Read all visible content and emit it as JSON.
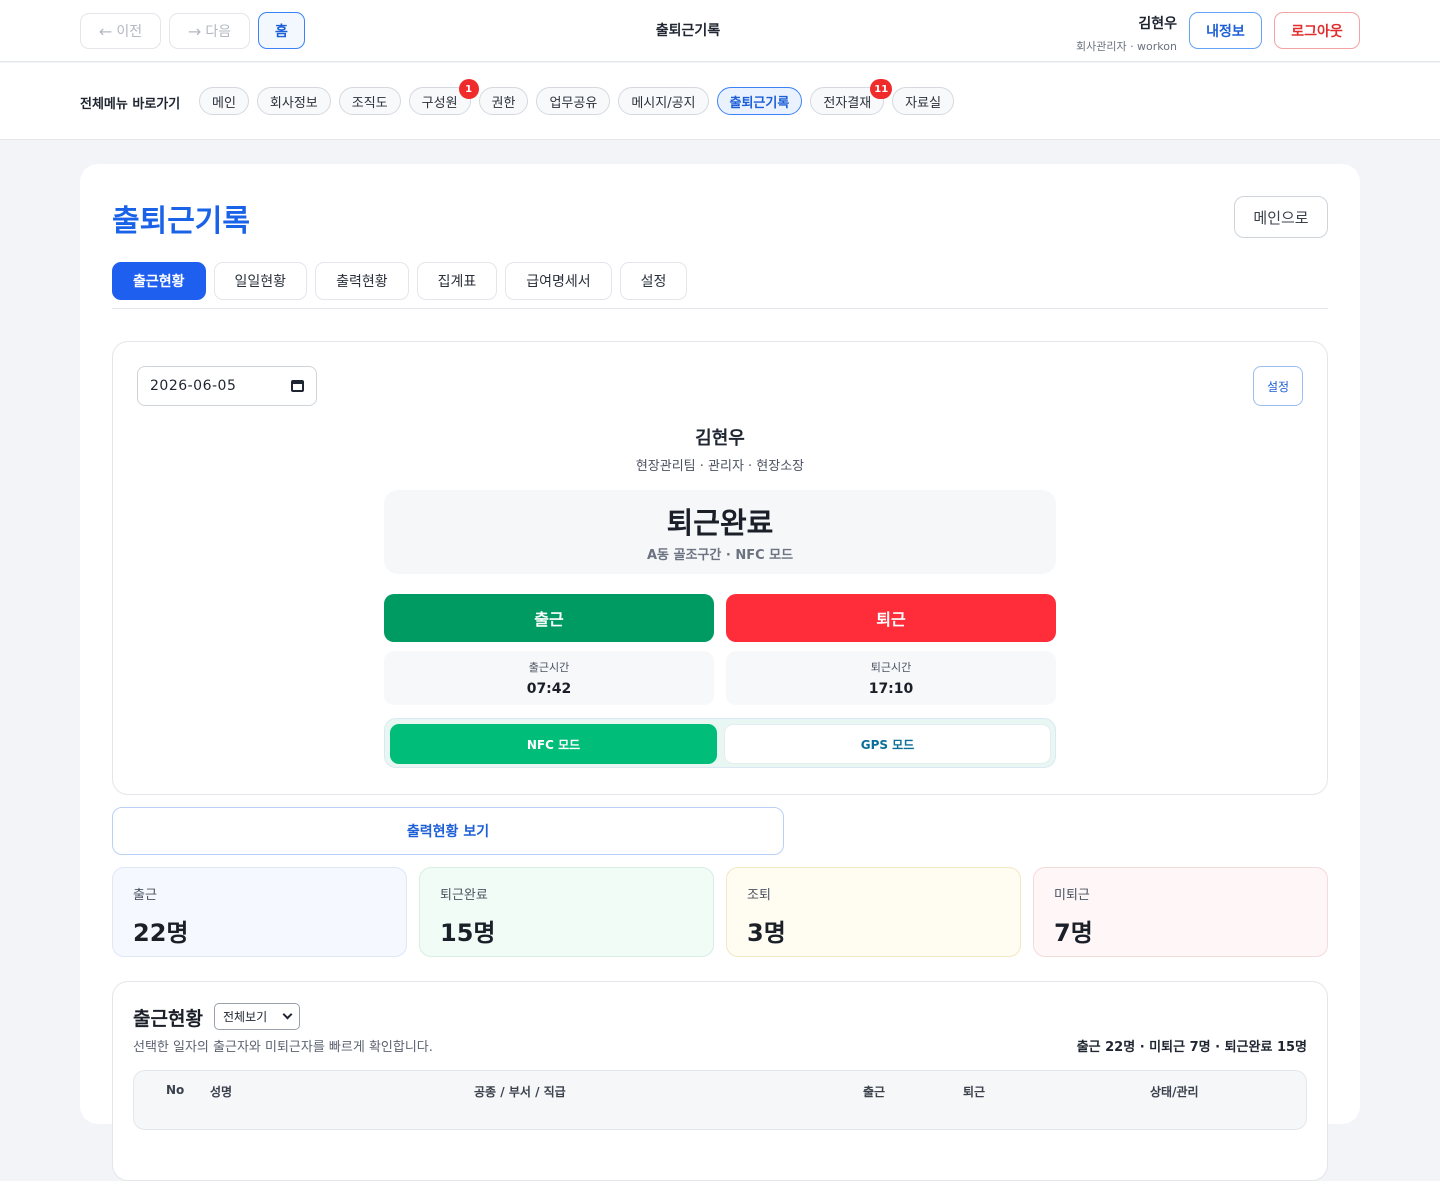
{
  "header": {
    "prev_label": "이전",
    "next_label": "다음",
    "home_label": "홈",
    "title": "출퇴근기록",
    "user_name": "김현우",
    "user_sub": "회사관리자 · workon",
    "myinfo_label": "내정보",
    "logout_label": "로그아웃"
  },
  "menu": {
    "label": "전체메뉴 바로가기",
    "items": [
      {
        "label": "메인"
      },
      {
        "label": "회사정보"
      },
      {
        "label": "조직도"
      },
      {
        "label": "구성원",
        "badge": "1"
      },
      {
        "label": "권한"
      },
      {
        "label": "업무공유"
      },
      {
        "label": "메시지/공지"
      },
      {
        "label": "출퇴근기록",
        "active": true
      },
      {
        "label": "전자결재",
        "badge": "11"
      },
      {
        "label": "자료실"
      }
    ]
  },
  "page": {
    "title": "출퇴근기록",
    "to_main_label": "메인으로",
    "tabs": [
      {
        "label": "출근현황",
        "active": true
      },
      {
        "label": "일일현황"
      },
      {
        "label": "출력현황"
      },
      {
        "label": "집계표"
      },
      {
        "label": "급여명세서"
      },
      {
        "label": "설정"
      }
    ]
  },
  "attendance": {
    "date": "2026-06-05",
    "settings_label": "설정",
    "employee_name": "김현우",
    "employee_sub": "현장관리팀 · 관리자 · 현장소장",
    "status": "퇴근완료",
    "location": "A동 골조구간 · NFC 모드",
    "clock_in_label": "출근",
    "clock_out_label": "퇴근",
    "clock_in_time_label": "출근시간",
    "clock_in_time": "07:42",
    "clock_out_time_label": "퇴근시간",
    "clock_out_time": "17:10",
    "mode_nfc": "NFC 모드",
    "mode_gps": "GPS 모드",
    "active_mode": "NFC"
  },
  "report_button_label": "출력현황 보기",
  "stats": [
    {
      "label": "출근",
      "value": "22명"
    },
    {
      "label": "퇴근완료",
      "value": "15명"
    },
    {
      "label": "조퇴",
      "value": "3명"
    },
    {
      "label": "미퇴근",
      "value": "7명"
    }
  ],
  "list": {
    "title": "출근현황",
    "filter_selected": "전체보기",
    "description": "선택한 일자의 출근자와 미퇴근자를 빠르게 확인합니다.",
    "summary": "출근 22명 · 미퇴근 7명 · 퇴근완료 15명",
    "columns": [
      "No",
      "성명",
      "공종 / 부서 / 직급",
      "출근",
      "퇴근",
      "상태/관리"
    ]
  },
  "colors": {
    "primary": "#1f5ff0",
    "clock_in": "#009a63",
    "clock_out": "#ff2d3a",
    "nfc_active": "#00bd7a",
    "badge": "#ef2b2b"
  }
}
